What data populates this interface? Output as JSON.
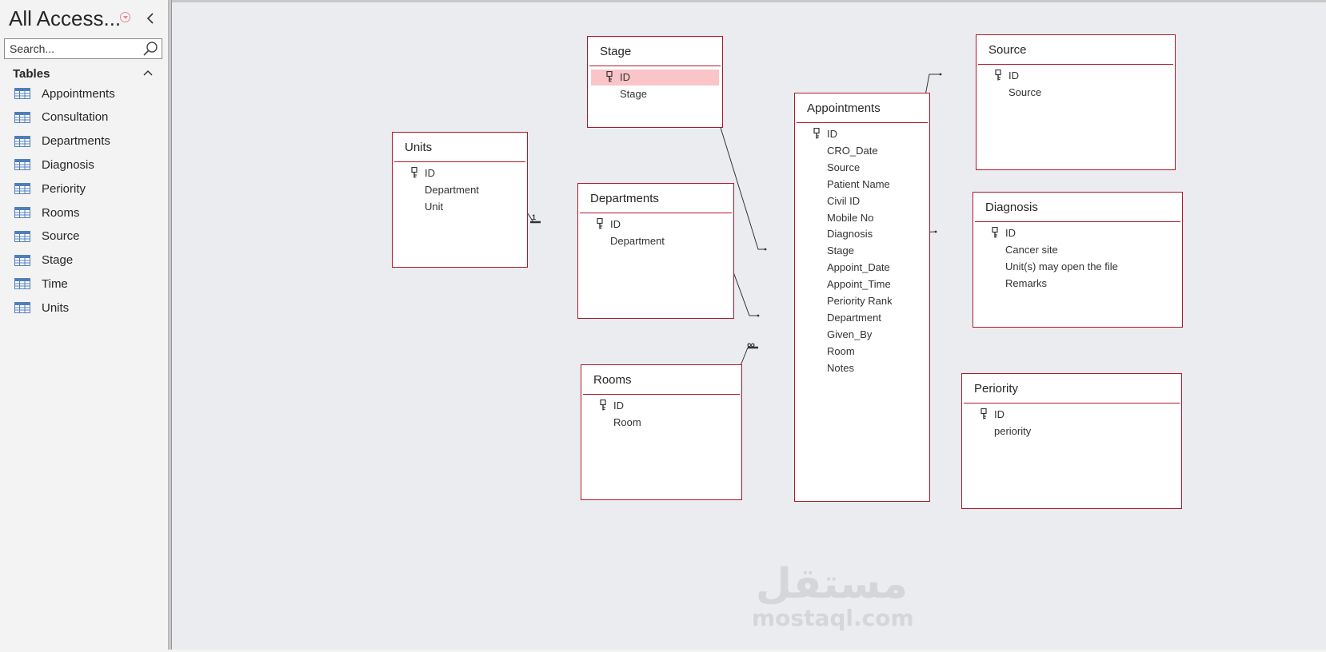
{
  "nav": {
    "title": "All Access...",
    "search_placeholder": "Search...",
    "section": "Tables",
    "items": [
      "Appointments",
      "Consultation",
      "Departments",
      "Diagnosis",
      "Periority",
      "Rooms",
      "Source",
      "Stage",
      "Time",
      "Units"
    ]
  },
  "tables": {
    "stage": {
      "title": "Stage",
      "fields": [
        "ID",
        "Stage"
      ]
    },
    "source": {
      "title": "Source",
      "fields": [
        "ID",
        "Source"
      ]
    },
    "units": {
      "title": "Units",
      "fields": [
        "ID",
        "Department",
        "Unit"
      ]
    },
    "departments": {
      "title": "Departments",
      "fields": [
        "ID",
        "Department"
      ]
    },
    "appointments": {
      "title": "Appointments",
      "fields": [
        "ID",
        "CRO_Date",
        "Source",
        "Patient Name",
        "Civil ID",
        "Mobile No",
        "Diagnosis",
        "Stage",
        "Appoint_Date",
        "Appoint_Time",
        "Periority Rank",
        "Department",
        "Given_By",
        "Room",
        "Notes"
      ]
    },
    "diagnosis": {
      "title": "Diagnosis",
      "fields": [
        "ID",
        "Cancer site",
        "Unit(s) may open the file",
        "Remarks"
      ]
    },
    "rooms": {
      "title": "Rooms",
      "fields": [
        "ID",
        "Room"
      ]
    },
    "periority": {
      "title": "Periority",
      "fields": [
        "ID",
        "periority"
      ]
    }
  },
  "relationships": {
    "one_label": "1",
    "many_label": "∞"
  },
  "watermark": {
    "arabic": "مستقل",
    "latin": "mostaql.com"
  },
  "colors": {
    "accent": "#b0182a",
    "highlight": "#f9c5c9",
    "canvas": "#eaecef"
  }
}
